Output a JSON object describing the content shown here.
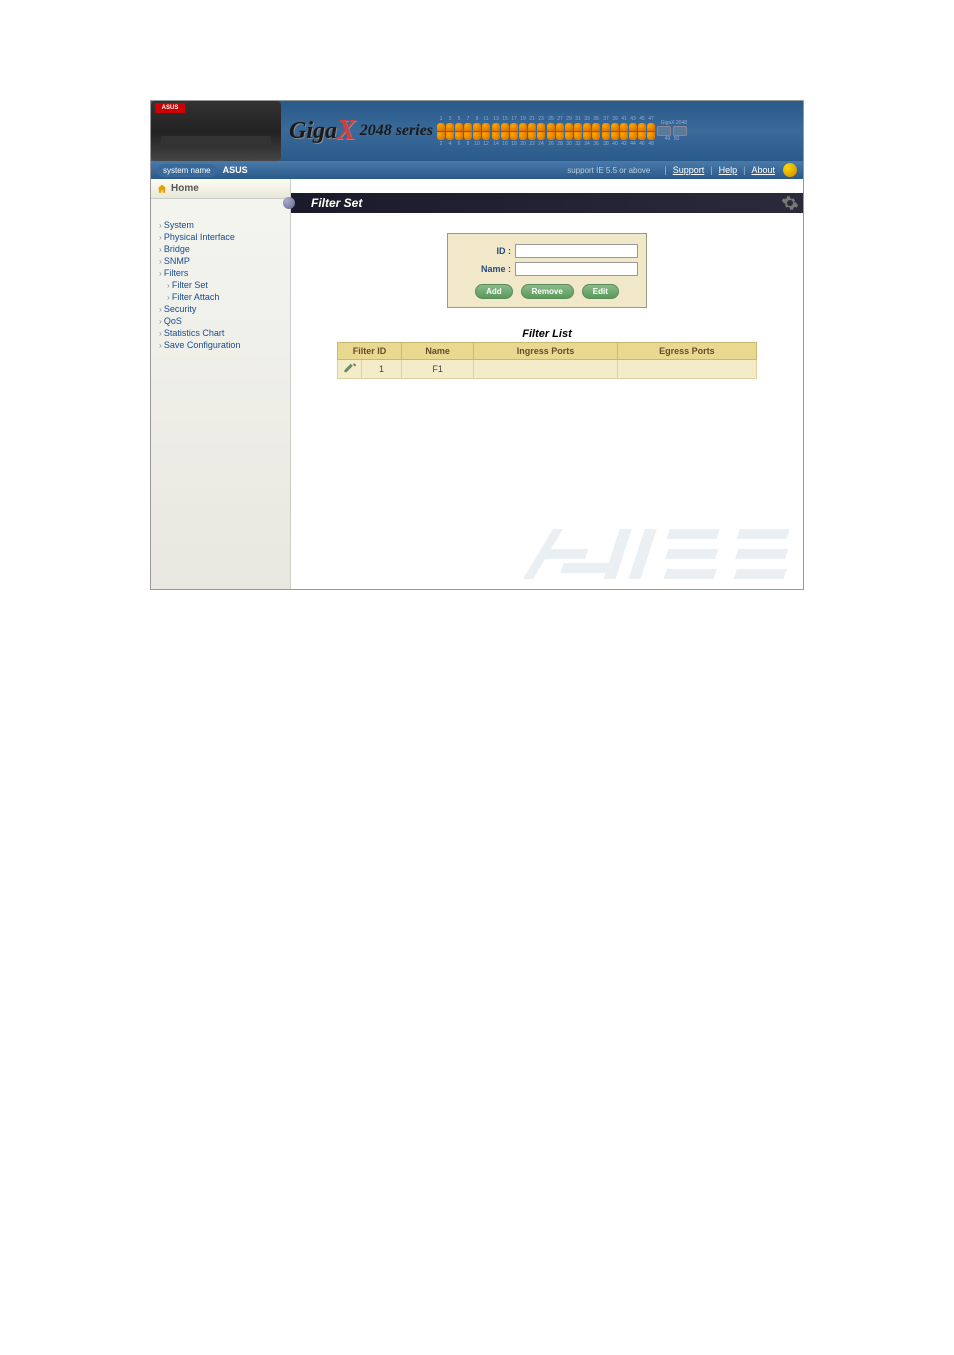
{
  "brand": {
    "asus_badge": "ASUS",
    "giga": "Giga",
    "x": "X",
    "series": "2048 series",
    "gigax_model": "GigaX 2048"
  },
  "system_bar": {
    "label": "system name",
    "value": "ASUS",
    "browser_req": "support IE 5.5 or above",
    "links": {
      "support": "Support",
      "help": "Help",
      "about": "About"
    }
  },
  "sidebar": {
    "home": "Home",
    "items": [
      {
        "label": "System",
        "sub": false
      },
      {
        "label": "Physical Interface",
        "sub": false
      },
      {
        "label": "Bridge",
        "sub": false
      },
      {
        "label": "SNMP",
        "sub": false
      },
      {
        "label": "Filters",
        "sub": false,
        "expanded": true
      },
      {
        "label": "Filter Set",
        "sub": true
      },
      {
        "label": "Filter Attach",
        "sub": true
      },
      {
        "label": "Security",
        "sub": false
      },
      {
        "label": "QoS",
        "sub": false
      },
      {
        "label": "Statistics Chart",
        "sub": false
      },
      {
        "label": "Save Configuration",
        "sub": false
      }
    ]
  },
  "panel": {
    "title": "Filter Set",
    "form": {
      "id_label": "ID :",
      "id_value": "",
      "name_label": "Name :",
      "name_value": "",
      "buttons": {
        "add": "Add",
        "remove": "Remove",
        "edit": "Edit"
      }
    },
    "list_title": "Filter List",
    "table": {
      "headers": {
        "id": "Filter ID",
        "name": "Name",
        "ingress": "Ingress Ports",
        "egress": "Egress Ports"
      },
      "rows": [
        {
          "id": "1",
          "name": "F1",
          "ingress": "",
          "egress": ""
        }
      ]
    }
  },
  "ports": {
    "top_nums": [
      "1",
      "3",
      "5",
      "7",
      "9",
      "11",
      "13",
      "15",
      "17",
      "19",
      "21",
      "23",
      "25",
      "27",
      "29",
      "31",
      "33",
      "35",
      "37",
      "39",
      "41",
      "43",
      "45",
      "47"
    ],
    "bottom_nums": [
      "2",
      "4",
      "6",
      "8",
      "10",
      "12",
      "14",
      "16",
      "18",
      "20",
      "22",
      "24",
      "26",
      "28",
      "30",
      "32",
      "34",
      "36",
      "38",
      "40",
      "42",
      "44",
      "46",
      "48"
    ],
    "sfp": [
      "49",
      "50"
    ]
  }
}
